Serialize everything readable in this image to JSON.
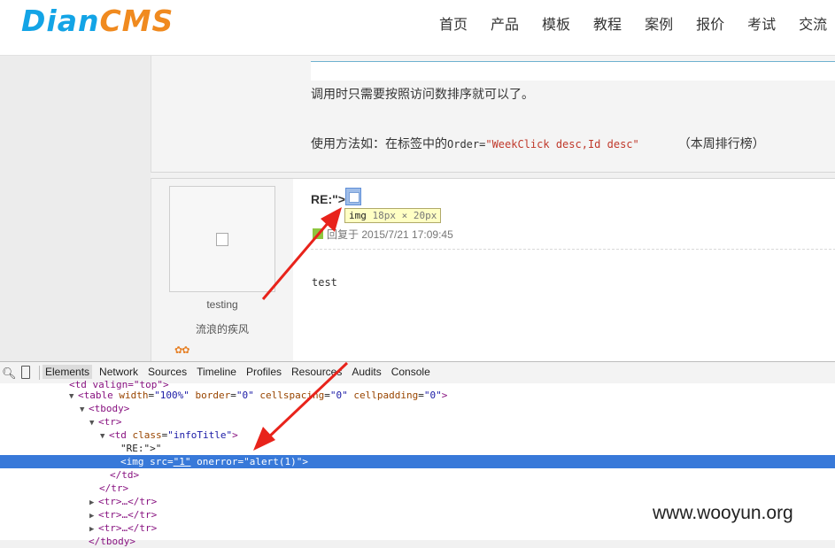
{
  "header": {
    "logo_part1": "Dian",
    "logo_part2": "CMS",
    "nav": [
      "首页",
      "产品",
      "模板",
      "教程",
      "案例",
      "报价",
      "考试",
      "交流"
    ]
  },
  "article": {
    "line1": "调用时只需要按照访问数排序就可以了。",
    "line2_prefix": "使用方法如：在标签中的",
    "line2_code": "Order=",
    "line2_value": "\"WeekClick desc,Id desc\"",
    "line2_suffix": "（本周排行榜）"
  },
  "reply": {
    "avatar_icon": "broken-image-icon",
    "username": "testing",
    "user_title": "流浪的疾风",
    "stars": "✿✿",
    "title": "RE:\">",
    "tooltip_tag": "img",
    "tooltip_size": "18px × 20px",
    "reply_meta": "回复于 2015/7/21 17:09:45",
    "body": "test"
  },
  "devtools": {
    "tabs": [
      "Elements",
      "Network",
      "Sources",
      "Timeline",
      "Profiles",
      "Resources",
      "Audits",
      "Console"
    ],
    "active_tab": "Elements",
    "lines": {
      "l1": "<td valign=\"top\">",
      "table_tag": "table",
      "table_a1": "width",
      "table_v1": "\"100%\"",
      "table_a2": "border",
      "table_v2": "\"0\"",
      "table_a3": "cellspacing",
      "table_v3": "\"0\"",
      "table_a4": "cellpadding",
      "table_v4": "\"0\"",
      "tbody": "<tbody>",
      "tr": "<tr>",
      "td_tag": "td",
      "td_a": "class",
      "td_v": "\"infoTitle\"",
      "text_node": "\"RE:\">\"",
      "img_tag": "img",
      "img_a1": "src",
      "img_v1": "\"1\"",
      "img_a2": "onerror",
      "img_v2": "\"alert(1)\"",
      "td_close": "</td>",
      "tr_close": "</tr>",
      "tr_collapsed": "<tr>…</tr>",
      "tbody_close": "</tbody>"
    }
  },
  "watermark": "www.wooyun.org",
  "colors": {
    "accent_blue": "#13a4e6",
    "accent_orange": "#f08a1f",
    "selection": "#3879d9",
    "arrow": "#e8231b"
  }
}
